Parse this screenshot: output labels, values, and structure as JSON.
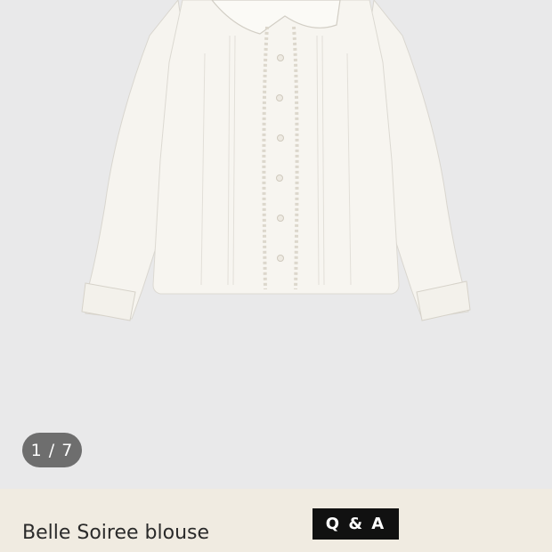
{
  "gallery": {
    "image_icon": "white-blouse-product-photo",
    "counter": "1 / 7"
  },
  "product": {
    "title": "Belle Soiree blouse",
    "qa_label": "Q & A"
  },
  "colors": {
    "gallery_bg": "#e9e9ea",
    "info_bg": "#f0ebe1",
    "counter_bg": "#6e6e6e",
    "qa_bg": "#111111"
  }
}
